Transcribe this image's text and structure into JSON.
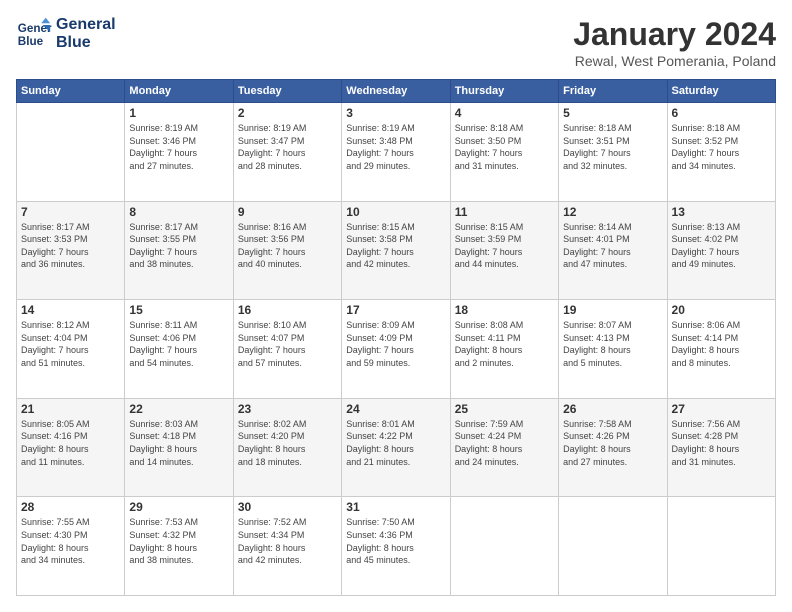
{
  "logo": {
    "line1": "General",
    "line2": "Blue"
  },
  "header": {
    "month": "January 2024",
    "location": "Rewal, West Pomerania, Poland"
  },
  "weekdays": [
    "Sunday",
    "Monday",
    "Tuesday",
    "Wednesday",
    "Thursday",
    "Friday",
    "Saturday"
  ],
  "weeks": [
    [
      {
        "day": "",
        "info": ""
      },
      {
        "day": "1",
        "info": "Sunrise: 8:19 AM\nSunset: 3:46 PM\nDaylight: 7 hours\nand 27 minutes."
      },
      {
        "day": "2",
        "info": "Sunrise: 8:19 AM\nSunset: 3:47 PM\nDaylight: 7 hours\nand 28 minutes."
      },
      {
        "day": "3",
        "info": "Sunrise: 8:19 AM\nSunset: 3:48 PM\nDaylight: 7 hours\nand 29 minutes."
      },
      {
        "day": "4",
        "info": "Sunrise: 8:18 AM\nSunset: 3:50 PM\nDaylight: 7 hours\nand 31 minutes."
      },
      {
        "day": "5",
        "info": "Sunrise: 8:18 AM\nSunset: 3:51 PM\nDaylight: 7 hours\nand 32 minutes."
      },
      {
        "day": "6",
        "info": "Sunrise: 8:18 AM\nSunset: 3:52 PM\nDaylight: 7 hours\nand 34 minutes."
      }
    ],
    [
      {
        "day": "7",
        "info": "Sunrise: 8:17 AM\nSunset: 3:53 PM\nDaylight: 7 hours\nand 36 minutes."
      },
      {
        "day": "8",
        "info": "Sunrise: 8:17 AM\nSunset: 3:55 PM\nDaylight: 7 hours\nand 38 minutes."
      },
      {
        "day": "9",
        "info": "Sunrise: 8:16 AM\nSunset: 3:56 PM\nDaylight: 7 hours\nand 40 minutes."
      },
      {
        "day": "10",
        "info": "Sunrise: 8:15 AM\nSunset: 3:58 PM\nDaylight: 7 hours\nand 42 minutes."
      },
      {
        "day": "11",
        "info": "Sunrise: 8:15 AM\nSunset: 3:59 PM\nDaylight: 7 hours\nand 44 minutes."
      },
      {
        "day": "12",
        "info": "Sunrise: 8:14 AM\nSunset: 4:01 PM\nDaylight: 7 hours\nand 47 minutes."
      },
      {
        "day": "13",
        "info": "Sunrise: 8:13 AM\nSunset: 4:02 PM\nDaylight: 7 hours\nand 49 minutes."
      }
    ],
    [
      {
        "day": "14",
        "info": "Sunrise: 8:12 AM\nSunset: 4:04 PM\nDaylight: 7 hours\nand 51 minutes."
      },
      {
        "day": "15",
        "info": "Sunrise: 8:11 AM\nSunset: 4:06 PM\nDaylight: 7 hours\nand 54 minutes."
      },
      {
        "day": "16",
        "info": "Sunrise: 8:10 AM\nSunset: 4:07 PM\nDaylight: 7 hours\nand 57 minutes."
      },
      {
        "day": "17",
        "info": "Sunrise: 8:09 AM\nSunset: 4:09 PM\nDaylight: 7 hours\nand 59 minutes."
      },
      {
        "day": "18",
        "info": "Sunrise: 8:08 AM\nSunset: 4:11 PM\nDaylight: 8 hours\nand 2 minutes."
      },
      {
        "day": "19",
        "info": "Sunrise: 8:07 AM\nSunset: 4:13 PM\nDaylight: 8 hours\nand 5 minutes."
      },
      {
        "day": "20",
        "info": "Sunrise: 8:06 AM\nSunset: 4:14 PM\nDaylight: 8 hours\nand 8 minutes."
      }
    ],
    [
      {
        "day": "21",
        "info": "Sunrise: 8:05 AM\nSunset: 4:16 PM\nDaylight: 8 hours\nand 11 minutes."
      },
      {
        "day": "22",
        "info": "Sunrise: 8:03 AM\nSunset: 4:18 PM\nDaylight: 8 hours\nand 14 minutes."
      },
      {
        "day": "23",
        "info": "Sunrise: 8:02 AM\nSunset: 4:20 PM\nDaylight: 8 hours\nand 18 minutes."
      },
      {
        "day": "24",
        "info": "Sunrise: 8:01 AM\nSunset: 4:22 PM\nDaylight: 8 hours\nand 21 minutes."
      },
      {
        "day": "25",
        "info": "Sunrise: 7:59 AM\nSunset: 4:24 PM\nDaylight: 8 hours\nand 24 minutes."
      },
      {
        "day": "26",
        "info": "Sunrise: 7:58 AM\nSunset: 4:26 PM\nDaylight: 8 hours\nand 27 minutes."
      },
      {
        "day": "27",
        "info": "Sunrise: 7:56 AM\nSunset: 4:28 PM\nDaylight: 8 hours\nand 31 minutes."
      }
    ],
    [
      {
        "day": "28",
        "info": "Sunrise: 7:55 AM\nSunset: 4:30 PM\nDaylight: 8 hours\nand 34 minutes."
      },
      {
        "day": "29",
        "info": "Sunrise: 7:53 AM\nSunset: 4:32 PM\nDaylight: 8 hours\nand 38 minutes."
      },
      {
        "day": "30",
        "info": "Sunrise: 7:52 AM\nSunset: 4:34 PM\nDaylight: 8 hours\nand 42 minutes."
      },
      {
        "day": "31",
        "info": "Sunrise: 7:50 AM\nSunset: 4:36 PM\nDaylight: 8 hours\nand 45 minutes."
      },
      {
        "day": "",
        "info": ""
      },
      {
        "day": "",
        "info": ""
      },
      {
        "day": "",
        "info": ""
      }
    ]
  ]
}
